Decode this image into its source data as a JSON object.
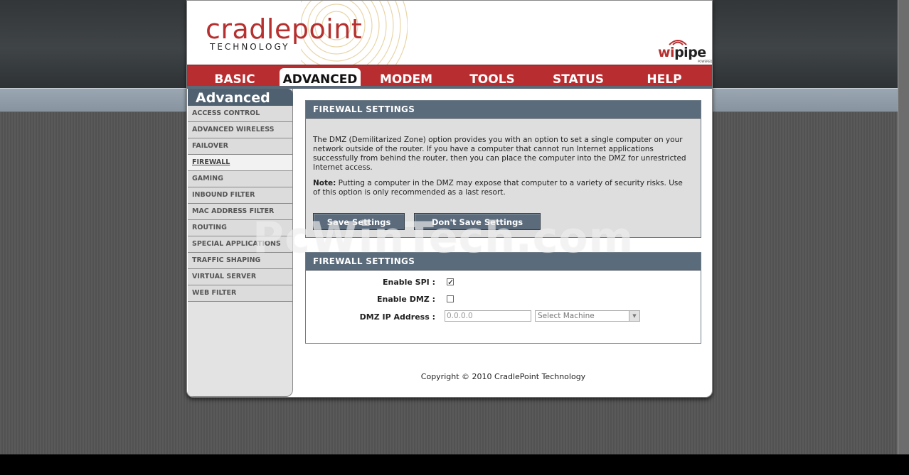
{
  "brand": {
    "logo_main": "cradlepoint",
    "logo_sub": "TECHNOLOGY",
    "partner_logo_prefix": "wi",
    "partner_logo_suffix": "pipe",
    "partner_logo_tagline": "POWERED"
  },
  "nav": {
    "tabs": [
      {
        "label": "BASIC"
      },
      {
        "label": "ADVANCED"
      },
      {
        "label": "MODEM"
      },
      {
        "label": "TOOLS"
      },
      {
        "label": "STATUS"
      },
      {
        "label": "HELP"
      }
    ],
    "active": "ADVANCED"
  },
  "sidebar": {
    "title": "Advanced",
    "items": [
      {
        "label": "ACCESS CONTROL"
      },
      {
        "label": "ADVANCED WIRELESS"
      },
      {
        "label": "FAILOVER"
      },
      {
        "label": "FIREWALL"
      },
      {
        "label": "GAMING"
      },
      {
        "label": "INBOUND FILTER"
      },
      {
        "label": "MAC ADDRESS FILTER"
      },
      {
        "label": "ROUTING"
      },
      {
        "label": "SPECIAL APPLICATIONS"
      },
      {
        "label": "TRAFFIC SHAPING"
      },
      {
        "label": "VIRTUAL SERVER"
      },
      {
        "label": "WEB FILTER"
      }
    ],
    "active": "FIREWALL"
  },
  "intro_box": {
    "title": "FIREWALL SETTINGS",
    "description": "The DMZ (Demilitarized Zone) option provides you with an option to set a single computer on your network outside of the router. If you have a computer that cannot run Internet applications successfully from behind the router, then you can place the computer into the DMZ for unrestricted Internet access.",
    "note_label": "Note:",
    "note_text": " Putting a computer in the DMZ may expose that computer to a variety of security risks. Use of this option is only recommended as a last resort.",
    "save_label": "Save Settings",
    "dont_save_label": "Don't Save Settings"
  },
  "settings_box": {
    "title": "FIREWALL SETTINGS",
    "enable_spi_label": "Enable SPI :",
    "enable_spi_checked": true,
    "enable_dmz_label": "Enable DMZ :",
    "enable_dmz_checked": false,
    "dmz_ip_label": "DMZ IP Address :",
    "dmz_ip_value": "0.0.0.0",
    "machine_select_value": "Select Machine"
  },
  "footer": {
    "copyright": "Copyright © 2010 CradlePoint Technology"
  },
  "watermark": "PcWinTech.com",
  "colors": {
    "brand_red": "#b82d30",
    "header_slate": "#5a6b7c"
  }
}
